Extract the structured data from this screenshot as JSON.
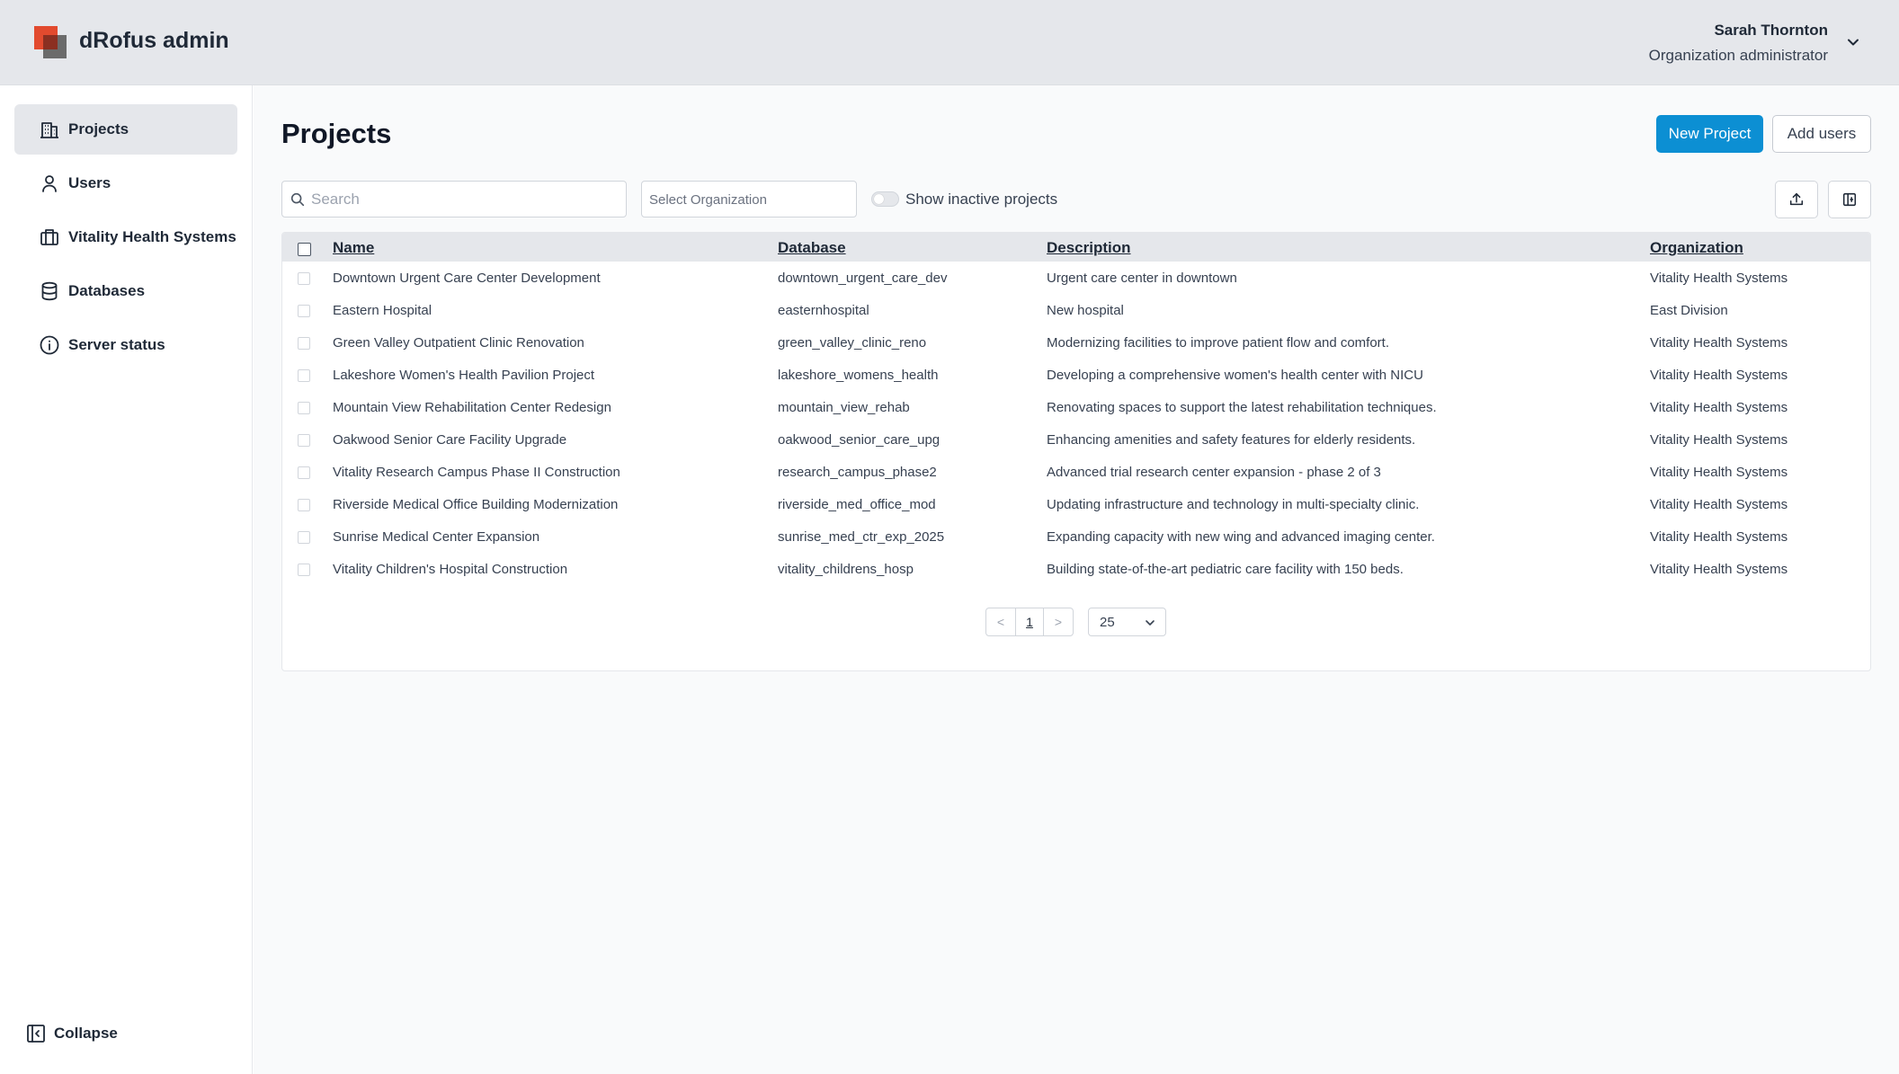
{
  "app": {
    "title": "dRofus admin"
  },
  "user": {
    "name": "Sarah Thornton",
    "role": "Organization administrator"
  },
  "sidebar": {
    "items": [
      {
        "label": "Projects",
        "icon": "building-icon",
        "active": true
      },
      {
        "label": "Users",
        "icon": "user-icon",
        "active": false
      },
      {
        "label": "Vitality Health Systems",
        "icon": "briefcase-icon",
        "active": false
      },
      {
        "label": "Databases",
        "icon": "database-icon",
        "active": false
      },
      {
        "label": "Server status",
        "icon": "info-icon",
        "active": false
      }
    ],
    "collapse_label": "Collapse"
  },
  "main": {
    "title": "Projects",
    "new_project_label": "New Project",
    "add_users_label": "Add users",
    "search_placeholder": "Search",
    "org_select_placeholder": "Select Organization",
    "show_inactive_label": "Show inactive projects",
    "show_inactive_on": false
  },
  "table": {
    "columns": [
      "Name",
      "Database",
      "Description",
      "Organization"
    ],
    "rows": [
      {
        "name": "Downtown Urgent Care Center Development",
        "database": "downtown_urgent_care_dev",
        "description": "Urgent care center in downtown",
        "organization": "Vitality Health Systems"
      },
      {
        "name": "Eastern Hospital",
        "database": "easternhospital",
        "description": "New hospital",
        "organization": "East Division"
      },
      {
        "name": "Green Valley Outpatient Clinic Renovation",
        "database": "green_valley_clinic_reno",
        "description": "Modernizing facilities to improve patient flow and comfort.",
        "organization": "Vitality Health Systems"
      },
      {
        "name": "Lakeshore Women's Health Pavilion Project",
        "database": "lakeshore_womens_health",
        "description": "Developing a comprehensive women's health center with NICU",
        "organization": "Vitality Health Systems"
      },
      {
        "name": "Mountain View Rehabilitation Center Redesign",
        "database": "mountain_view_rehab",
        "description": "Renovating spaces to support the latest rehabilitation techniques.",
        "organization": "Vitality Health Systems"
      },
      {
        "name": "Oakwood Senior Care Facility Upgrade",
        "database": "oakwood_senior_care_upg",
        "description": "Enhancing amenities and safety features for elderly residents.",
        "organization": "Vitality Health Systems"
      },
      {
        "name": "Vitality Research Campus Phase II Construction",
        "database": "research_campus_phase2",
        "description": "Advanced trial research center expansion - phase 2 of 3",
        "organization": "Vitality Health Systems"
      },
      {
        "name": "Riverside Medical Office Building Modernization",
        "database": "riverside_med_office_mod",
        "description": "Updating infrastructure and technology in multi-specialty clinic.",
        "organization": "Vitality Health Systems"
      },
      {
        "name": "Sunrise Medical Center Expansion",
        "database": "sunrise_med_ctr_exp_2025",
        "description": "Expanding capacity with new wing and advanced imaging center.",
        "organization": "Vitality Health Systems"
      },
      {
        "name": "Vitality Children's Hospital Construction",
        "database": "vitality_childrens_hosp",
        "description": "Building state-of-the-art pediatric care facility with 150 beds.",
        "organization": "Vitality Health Systems"
      }
    ]
  },
  "pagination": {
    "prev": "<",
    "current_page": "1",
    "next": ">",
    "page_size": "25"
  },
  "colors": {
    "accent": "#0c8fd3",
    "logo_red": "#e24a2e",
    "logo_gray": "#6b6b6b"
  }
}
